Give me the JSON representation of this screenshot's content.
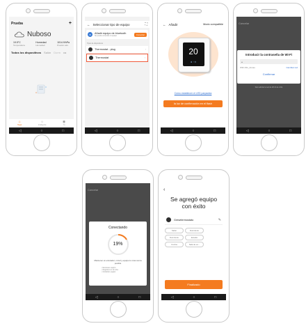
{
  "screen1": {
    "home_name": "Prueba",
    "weather": "Nuboso",
    "stats": [
      {
        "value": "19.5°C",
        "label": "Temperatura"
      },
      {
        "value": "Humedad",
        "label": "Humedad"
      },
      {
        "value": "1014.9/hPa",
        "label": "Presión atm."
      }
    ],
    "tabs": [
      "Todos los dispositivos",
      "Salón",
      "Dorm"
    ],
    "nav": [
      "Hogar",
      "Inteligente",
      "Yo"
    ]
  },
  "screen2": {
    "title": "Seleccionar tipo de equipo",
    "bt_title": "Añadir equipo de bluetooth",
    "bt_sub": "Se puede conectar el equipo",
    "bt_button": "Conectar",
    "section": "Tipos de dispositivos",
    "items": [
      "Thermostat - plug",
      "Thermostat"
    ]
  },
  "screen3": {
    "title": "Añadir",
    "mode": "Modo compatible",
    "display_value": "20",
    "link": "Cómo establecer el LED parpadea",
    "button": "la luz de confirmación en el flash"
  },
  "screen4": {
    "cancel": "Cancelar",
    "dialog_title": "Introducir la contraseña de Wi-Fi",
    "wifi_name": "WiFi-MG_Zonas",
    "change": "Cambiar red",
    "confirm": "Confirmar",
    "note": "Solo admite la red de Wi-Fi de 2.4G"
  },
  "screen5": {
    "cancel": "Cancelar",
    "title": "Conectando",
    "percent": "19%",
    "desc": "Mantener el enrutador, móvil y equipo lo más cerca posible",
    "steps": [
      "Escanear equipo",
      "Registrar en la nube",
      "Inicializar equipo"
    ]
  },
  "screen6": {
    "title": "Se agregó equipo con éxito",
    "device": "Gresetermostato",
    "rooms": [
      "Salón",
      "Dormitorio",
      "Dormitorio",
      "Estudio",
      "Cocina",
      "Sala de es..."
    ],
    "finish": "Finalizado"
  }
}
